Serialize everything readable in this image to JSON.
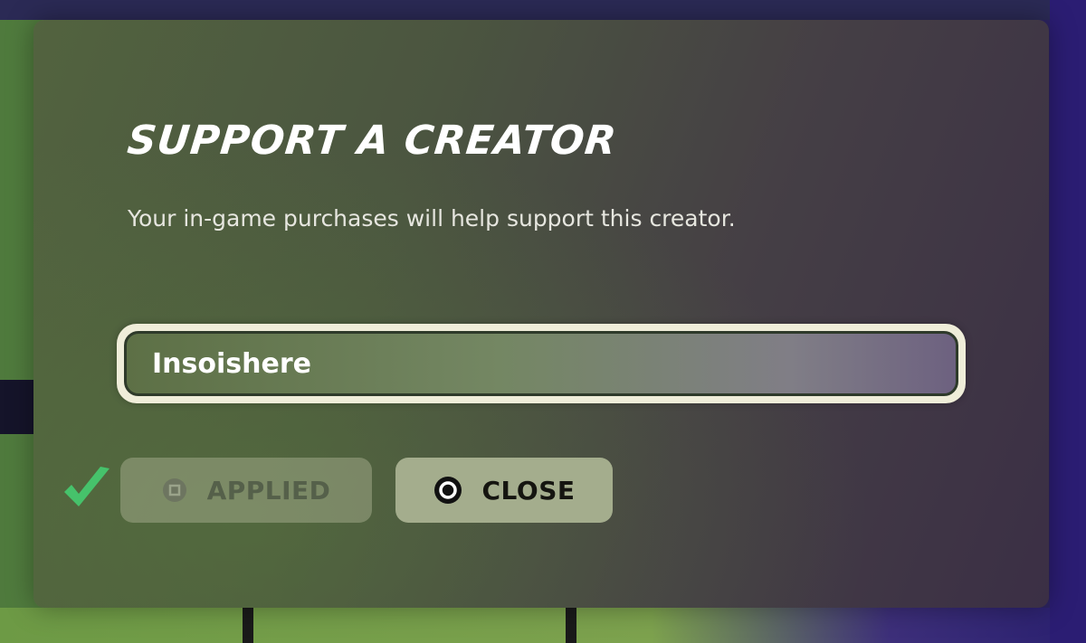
{
  "dialog": {
    "title": "SUPPORT A CREATOR",
    "subtitle": "Your in-game purchases will help support this creator."
  },
  "creator_code_input": {
    "value": "Insoishere"
  },
  "buttons": {
    "applied_label": "APPLIED",
    "close_label": "CLOSE"
  },
  "icons": {
    "applied_status": "check-icon",
    "applied_button": "square-button-icon",
    "close_button": "circle-button-icon"
  },
  "colors": {
    "check": "#46c26b",
    "title": "#ffffff",
    "input_border": "#efedd9"
  }
}
